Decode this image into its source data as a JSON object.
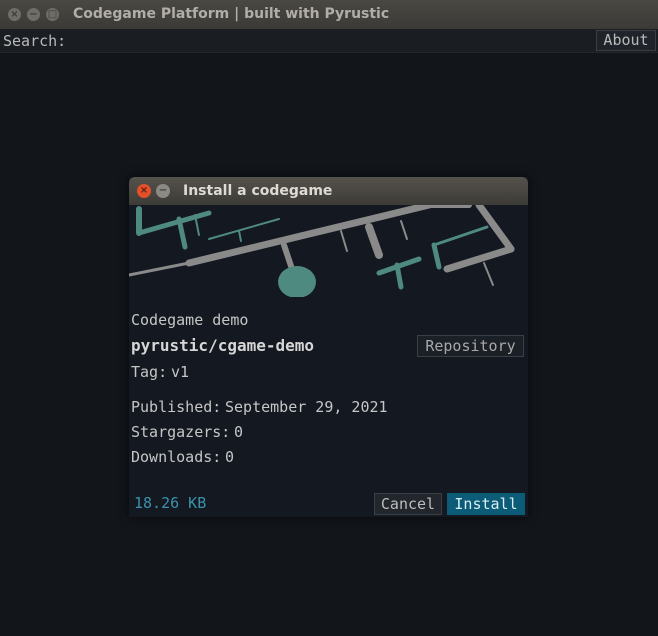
{
  "window": {
    "title": "Codegame Platform | built with Pyrustic",
    "controls": {
      "close": "×",
      "minimize": "−",
      "maximize": "□"
    }
  },
  "search": {
    "label": "Search:",
    "value": "",
    "placeholder": ""
  },
  "about_button": {
    "label": "About"
  },
  "dialog": {
    "title": "Install a codegame",
    "controls": {
      "close": "×",
      "minimize": "−"
    },
    "cover_icon": "maze-cover-image",
    "subtitle": "Codegame demo",
    "repository": "pyrustic/cgame-demo",
    "repository_button": "Repository",
    "tag_label": "Tag:",
    "tag_value": "v1",
    "published_label": "Published:",
    "published_value": "September 29, 2021",
    "stargazers_label": "Stargazers:",
    "stargazers_value": "0",
    "downloads_label": "Downloads:",
    "downloads_value": "0",
    "size": "18.26 KB",
    "cancel_button": "Cancel",
    "install_button": "Install"
  },
  "colors": {
    "background": "#121519",
    "accent": "#0c5c78",
    "size_text": "#3a92ad",
    "close_button": "#e3502a",
    "cover_teal": "#4f8a80",
    "cover_gray": "#8a8a8a"
  }
}
